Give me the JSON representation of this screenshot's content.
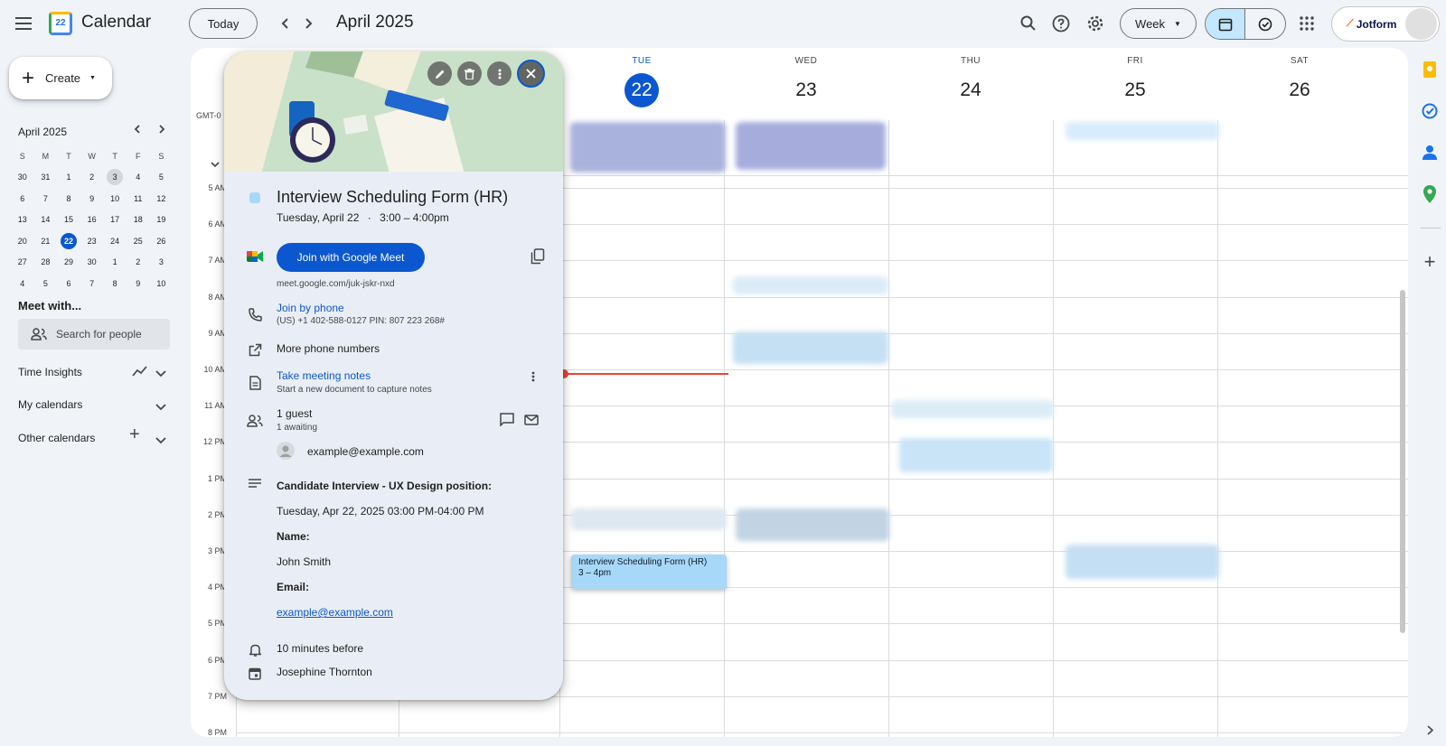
{
  "header": {
    "app_title": "Calendar",
    "logo_day": "22",
    "today_label": "Today",
    "current_period": "April 2025",
    "view_selector": "Week",
    "brand_label": "Jotform"
  },
  "sidebar": {
    "create_label": "Create",
    "mini_calendar": {
      "month_label": "April 2025",
      "weekday_headers": [
        "S",
        "M",
        "T",
        "W",
        "T",
        "F",
        "S"
      ],
      "weeks": [
        [
          "30",
          "31",
          "1",
          "2",
          "3",
          "4",
          "5"
        ],
        [
          "6",
          "7",
          "8",
          "9",
          "10",
          "11",
          "12"
        ],
        [
          "13",
          "14",
          "15",
          "16",
          "17",
          "18",
          "19"
        ],
        [
          "20",
          "21",
          "22",
          "23",
          "24",
          "25",
          "26"
        ],
        [
          "27",
          "28",
          "29",
          "30",
          "1",
          "2",
          "3"
        ],
        [
          "4",
          "5",
          "6",
          "7",
          "8",
          "9",
          "10"
        ]
      ],
      "selected_day": "22",
      "highlighted_day": "3"
    },
    "meet_with_label": "Meet with...",
    "search_people_placeholder": "Search for people",
    "time_insights_label": "Time Insights",
    "my_calendars_label": "My calendars",
    "other_calendars_label": "Other calendars"
  },
  "grid": {
    "timezone_label": "GMT-0",
    "days": [
      {
        "dow": "TUE",
        "num": "22",
        "today": true
      },
      {
        "dow": "WED",
        "num": "23"
      },
      {
        "dow": "THU",
        "num": "24"
      },
      {
        "dow": "FRI",
        "num": "25"
      },
      {
        "dow": "SAT",
        "num": "26"
      }
    ],
    "hour_labels": [
      "5 AM",
      "6 AM",
      "7 AM",
      "8 AM",
      "9 AM",
      "10 AM",
      "11 AM",
      "12 PM",
      "1 PM",
      "2 PM",
      "3 PM",
      "4 PM",
      "5 PM",
      "6 PM",
      "7 PM",
      "8 PM"
    ],
    "selected_event": {
      "title": "Interview Scheduling Form (HR)",
      "time": "3 – 4pm"
    }
  },
  "popup": {
    "title": "Interview Scheduling Form (HR)",
    "date": "Tuesday, April 22",
    "time_range": "3:00 – 4:00pm",
    "event_color": "#a8d8f8",
    "join_meet_label": "Join with Google Meet",
    "meet_link": "meet.google.com/juk-jskr-nxd",
    "join_phone_label": "Join by phone",
    "phone_details": "(US) +1 402-588-0127 PIN: 807 223 268#",
    "more_phone_label": "More phone numbers",
    "notes_label": "Take meeting notes",
    "notes_sub": "Start a new document to capture notes",
    "guests_count": "1 guest",
    "guests_awaiting": "1 awaiting",
    "guest_email": "example@example.com",
    "description": {
      "heading": "Candidate Interview - UX Design position:",
      "datetime": "Tuesday, Apr 22, 2025 03:00 PM-04:00 PM",
      "name_label": "Name:",
      "name_value": "John Smith",
      "email_label": "Email:",
      "email_value": "example@example.com"
    },
    "reminder": "10 minutes before",
    "organizer": "Josephine Thornton"
  },
  "colors": {
    "accent": "#0b57d0",
    "event_blue": "#a8d8f8",
    "now_line": "#ea4335"
  }
}
